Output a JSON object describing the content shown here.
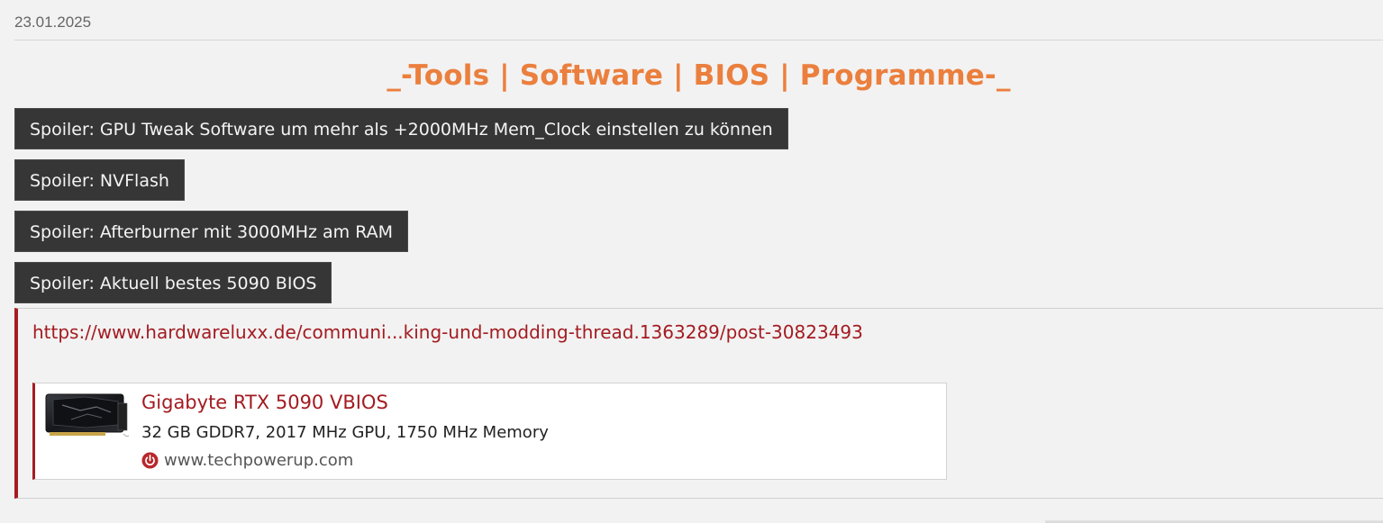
{
  "post": {
    "date": "23.01.2025",
    "heading": "_-Tools | Software | BIOS | Programme-_"
  },
  "spoilers": [
    {
      "label": "Spoiler: GPU Tweak Software um mehr als +2000MHz Mem_Clock einstellen zu können"
    },
    {
      "label": "Spoiler: NVFlash"
    },
    {
      "label": "Spoiler: Afterburner mit 3000MHz am RAM"
    },
    {
      "label": "Spoiler: Aktuell bestes 5090 BIOS"
    }
  ],
  "quote": {
    "link_text": "https://www.hardwareluxx.de/communi...king-und-modding-thread.1363289/post-30823493",
    "embed": {
      "title": "Gigabyte RTX 5090 VBIOS",
      "description": "32 GB GDDR7, 2017 MHz GPU, 1750 MHz Memory",
      "source": "www.techpowerup.com",
      "source_icon": "power-icon",
      "thumbnail": "graphics-card-image"
    }
  },
  "colors": {
    "heading_orange": "#eb7f3d",
    "link_red": "#a31b21",
    "spoiler_bg": "#363636"
  }
}
